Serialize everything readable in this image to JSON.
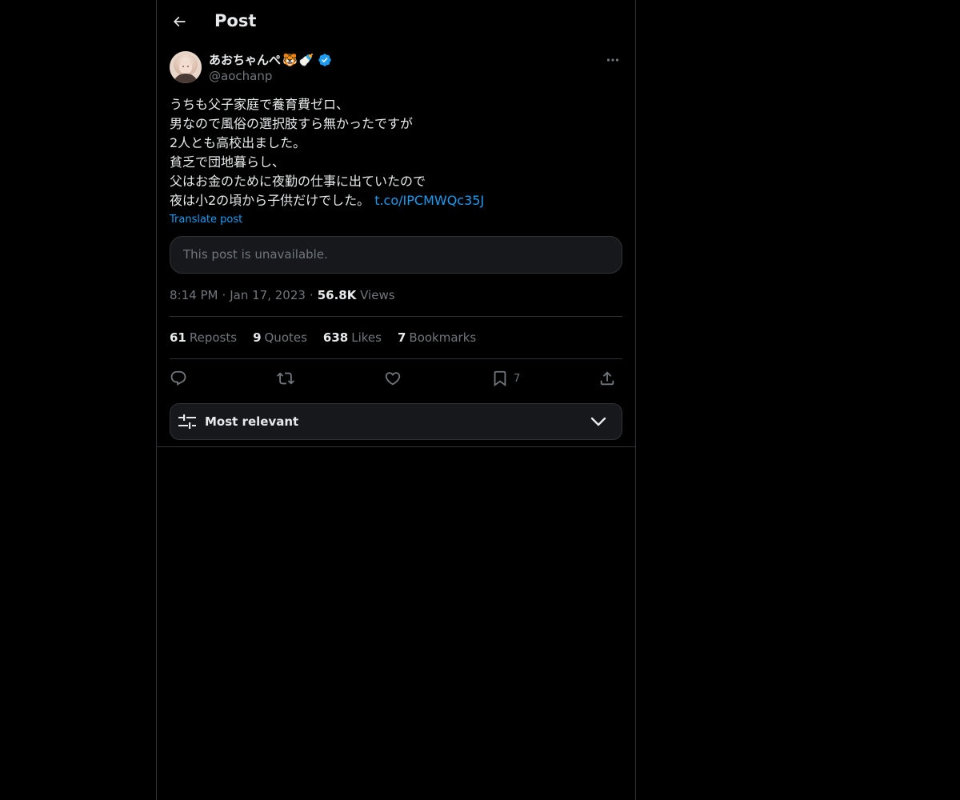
{
  "header": {
    "title": "Post",
    "back_icon": "arrow-left-icon"
  },
  "author": {
    "display_name": "あおちゃんぺ",
    "emoji_1": "🐯",
    "emoji_2": "🍼",
    "handle": "@aochanp",
    "verified": true,
    "verified_color": "#1d9bf0"
  },
  "post": {
    "lines": [
      "うちも父子家庭で養育費ゼロ、",
      "男なので風俗の選択肢すら無かったですが",
      "2人とも高校出ました。",
      "貧乏で団地暮らし、",
      "父はお金のために夜勤の仕事に出ていたので",
      "夜は小2の頃から子供だけでした。"
    ],
    "link": "t.co/IPCMWQc35J",
    "translate_label": "Translate post"
  },
  "quoted": {
    "text": "This post is unavailable."
  },
  "meta": {
    "time": "8:14 PM",
    "date": "Jan 17, 2023",
    "views_count": "56.8K",
    "views_label": "Views",
    "separator": "·"
  },
  "stats": [
    {
      "count": "61",
      "label": "Reposts"
    },
    {
      "count": "9",
      "label": "Quotes"
    },
    {
      "count": "638",
      "label": "Likes"
    },
    {
      "count": "7",
      "label": "Bookmarks"
    }
  ],
  "actions": {
    "reply_icon": "reply-icon",
    "repost_icon": "repost-icon",
    "like_icon": "heart-icon",
    "bookmark_icon": "bookmark-icon",
    "bookmark_count": "7",
    "share_icon": "share-icon"
  },
  "sort": {
    "label": "Most relevant",
    "icon": "sliders-icon",
    "chevron": "chevron-down-icon"
  },
  "colors": {
    "background": "#000000",
    "text": "#e7e9ea",
    "muted": "#71767b",
    "accent": "#1d9bf0",
    "border": "#2f3336",
    "card": "#16181c"
  }
}
